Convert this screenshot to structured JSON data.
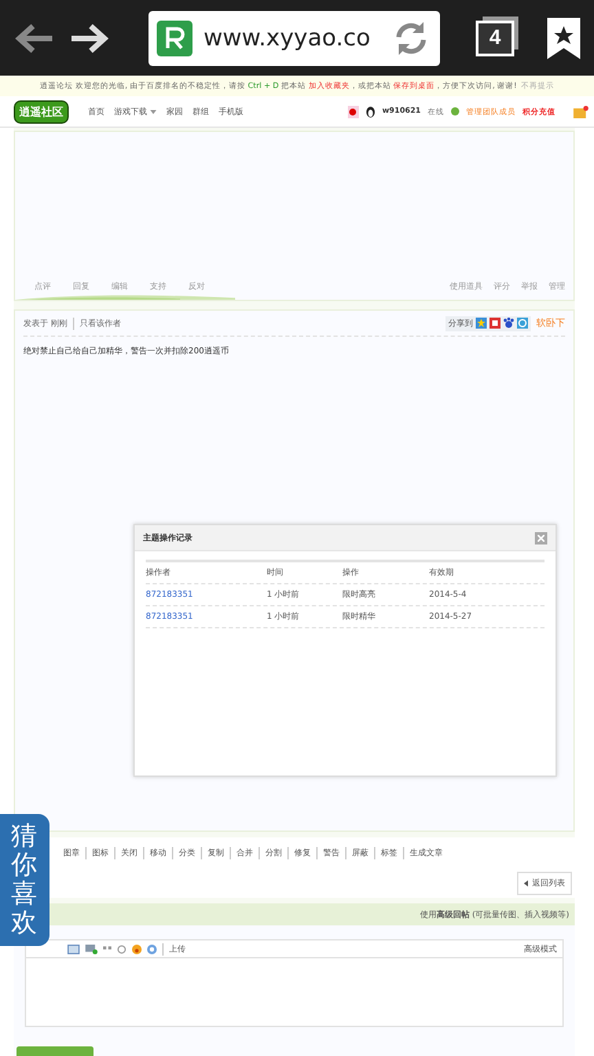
{
  "browser": {
    "url": "www.xyyao.co",
    "tab_count": "4"
  },
  "notice": {
    "segments": [
      {
        "kind": "plain",
        "text": "逍遥论坛 欢迎您的光临, 由于百度排名的不稳定性，请按 "
      },
      {
        "kind": "key",
        "text": "Ctrl + D"
      },
      {
        "kind": "plain",
        "text": " 把本站 "
      },
      {
        "kind": "link",
        "text": "加入收藏夹"
      },
      {
        "kind": "plain",
        "text": "，或把本站 "
      },
      {
        "kind": "link",
        "text": "保存到桌面"
      },
      {
        "kind": "plain",
        "text": "，方便下次访问, 谢谢!"
      }
    ],
    "dismiss": "不再提示"
  },
  "header": {
    "logo": "逍遥社区",
    "nav": [
      {
        "label": "首页",
        "dropdown": false
      },
      {
        "label": "游戏下载",
        "dropdown": true
      },
      {
        "label": "家园",
        "dropdown": false
      },
      {
        "label": "群组",
        "dropdown": false
      },
      {
        "label": "手机版",
        "dropdown": false
      }
    ],
    "username": "w910621",
    "status": "在线",
    "group": "管理团队成员",
    "recharge": "积分充值"
  },
  "post_1": {
    "actions": [
      "点评",
      "回复",
      "编辑",
      "支持",
      "反对"
    ],
    "tools": [
      "使用道具",
      "评分",
      "举报",
      "管理"
    ]
  },
  "post_2": {
    "posted": "发表于 刚刚",
    "author_only": "只看该作者",
    "share": "分享到",
    "extra": "软卧下",
    "content": "绝对禁止自己给自己加精华，警告一次并扣除200逍遥币"
  },
  "dialog": {
    "title": "主题操作记录",
    "columns": [
      "操作者",
      "时间",
      "操作",
      "有效期"
    ],
    "rows": [
      [
        "872183351",
        "1 小时前",
        "限时高亮",
        "2014-5-4"
      ],
      [
        "872183351",
        "1 小时前",
        "限时精华",
        "2014-5-27"
      ]
    ]
  },
  "mod_tools": [
    "图章",
    "图标",
    "关闭",
    "移动",
    "分类",
    "复制",
    "合并",
    "分割",
    "修复",
    "警告",
    "屏蔽",
    "标签",
    "生成文章"
  ],
  "back_to_list": "返回列表",
  "reply": {
    "hint": "使用**高级回帖** (可批量传图、插入视频等)",
    "upload": "上传",
    "advanced": "高级模式"
  },
  "widget": {
    "label": "猜你喜欢"
  }
}
